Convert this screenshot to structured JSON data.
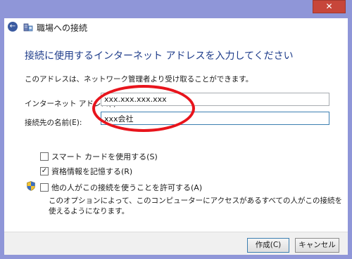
{
  "window": {
    "close_glyph": "✕"
  },
  "nav": {
    "back_glyph": "←",
    "title": "職場への接続",
    "icon": "workplace-network-icon"
  },
  "heading": "接続に使用するインターネット アドレスを入力してください",
  "description": "このアドレスは、ネットワーク管理者より受け取ることができます。",
  "fields": {
    "address_label": "インターネット アドレス(I):",
    "address_value": "xxx.xxx.xxx.xxx",
    "name_label": "接続先の名前(E):",
    "name_value": "xxx会社"
  },
  "options": {
    "smartcard": {
      "label": "スマート カードを使用する(S)",
      "checked": false
    },
    "remember": {
      "label": "資格情報を記憶する(R)",
      "checked": true,
      "check_glyph": "✓"
    },
    "allow_others": {
      "label": "他の人がこの接続を使うことを許可する(A)",
      "checked": false
    },
    "allow_others_note": "このオプションによって、このコンピューターにアクセスがあるすべての人がこの接続を使えるようになります。"
  },
  "buttons": {
    "create": "作成(C)",
    "cancel": "キャンセル"
  },
  "annotation_color": "#e8141c"
}
